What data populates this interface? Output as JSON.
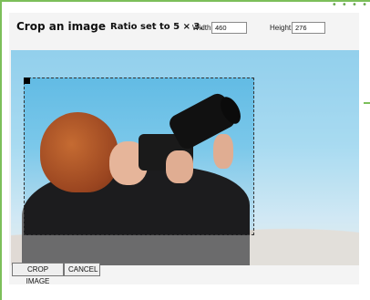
{
  "header": {
    "title": "Crop an image",
    "ratio_text": "Ratio set to 5 × 3.",
    "width_label": "Width:",
    "width_value": "460",
    "height_label": "Height:",
    "height_value": "276"
  },
  "buttons": {
    "crop_label": "CROP IMAGE",
    "cancel_label": "CANCEL"
  },
  "decor": {
    "corner_dots": "• • • •"
  },
  "colors": {
    "accent_border": "#7cbf5a",
    "card_background": "#f4f4f4"
  }
}
